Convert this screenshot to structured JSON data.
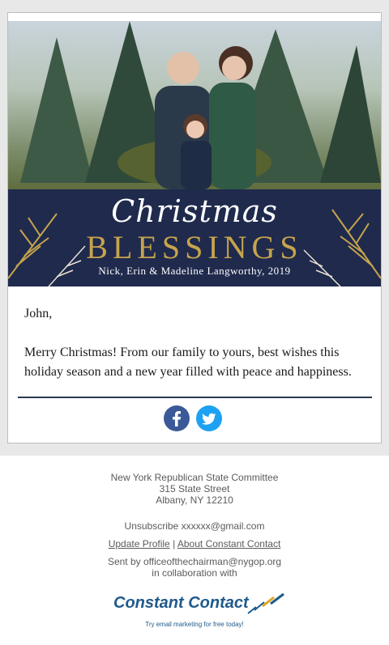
{
  "banner": {
    "script_title": "Christmas",
    "headline": "BLESSINGS",
    "names": "Nick, Erin & Madeline Langworthy, 2019"
  },
  "message": {
    "greeting": "John,",
    "body": "Merry Christmas! From our family to yours, best wishes this holiday season and a new year filled with peace and happiness."
  },
  "social": [
    {
      "icon": "facebook-icon",
      "color": "#3b5998"
    },
    {
      "icon": "twitter-icon",
      "color": "#1da1f2"
    }
  ],
  "footer": {
    "org_name": "New York Republican State Committee",
    "address_line1": "315 State Street",
    "address_line2": "Albany, NY 12210",
    "unsubscribe_label": "Unsubscribe",
    "email": "xxxxxx@gmail.com",
    "update_profile": "Update Profile",
    "separator": "|",
    "about_cc": "About Constant Contact",
    "sent_by": "Sent by officeofthechairman@nygop.org",
    "collab": "in collaboration with",
    "cc_logo_text": "Constant Contact",
    "cc_tagline": "Try email marketing for free today!"
  }
}
